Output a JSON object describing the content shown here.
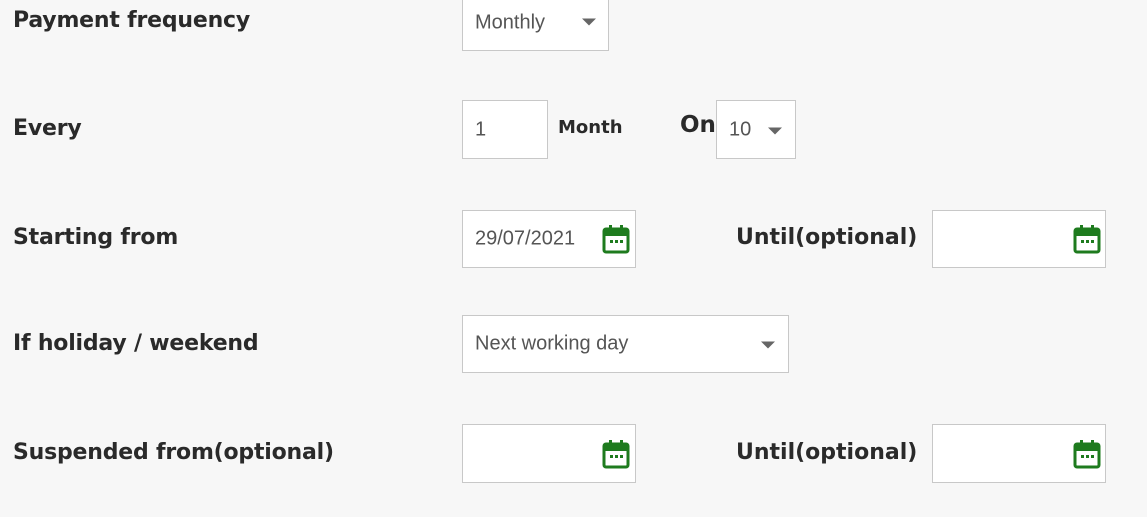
{
  "payment_frequency": {
    "label": "Payment frequency",
    "selected": "Monthly"
  },
  "every": {
    "label": "Every",
    "value": "1",
    "unit": "Month",
    "on_label": "On",
    "on_selected": "10"
  },
  "starting_from": {
    "label": "Starting from",
    "value": "29/07/2021",
    "until_label": "Until(optional)",
    "until_value": ""
  },
  "holiday": {
    "label": "If holiday / weekend",
    "selected": "Next working day"
  },
  "suspended": {
    "label": "Suspended from(optional)",
    "from_value": "",
    "until_label": "Until(optional)",
    "until_value": ""
  },
  "icons": {
    "calendar": "calendar-icon",
    "dropdown": "chevron-down-icon"
  },
  "colors": {
    "background": "#f7f7f7",
    "calendar_icon": "#1e7b1e",
    "border": "#c8c8c8"
  }
}
